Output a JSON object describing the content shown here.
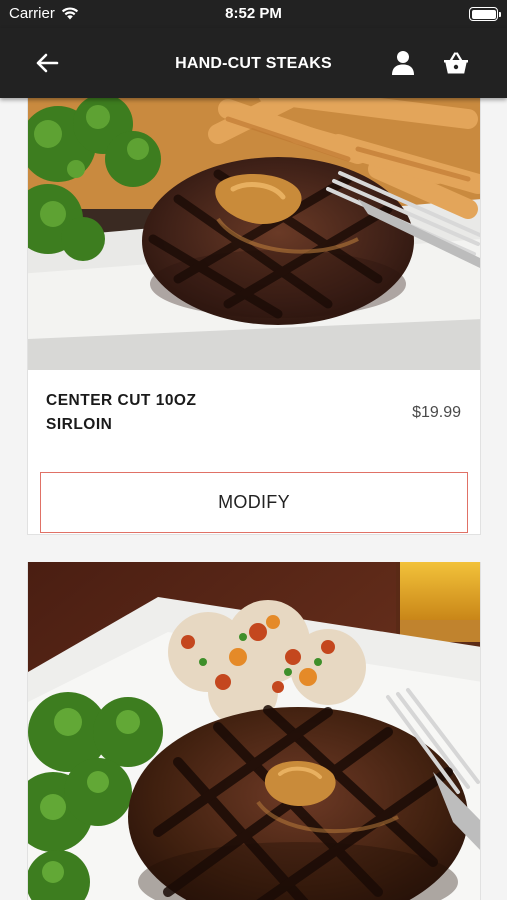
{
  "status_bar": {
    "carrier": "Carrier",
    "time": "8:52 PM"
  },
  "nav": {
    "title": "HAND-CUT STEAKS",
    "back_icon": "arrow-left-icon",
    "account_icon": "person-icon",
    "basket_icon": "basket-icon"
  },
  "menu_items": [
    {
      "name_line1": "CENTER CUT 10OZ",
      "name_line2": "SIRLOIN",
      "price": "$19.99",
      "button_label": "MODIFY"
    }
  ],
  "colors": {
    "header_bg": "#222222",
    "modify_border": "#e07166",
    "page_bg": "#f4f4f4"
  }
}
